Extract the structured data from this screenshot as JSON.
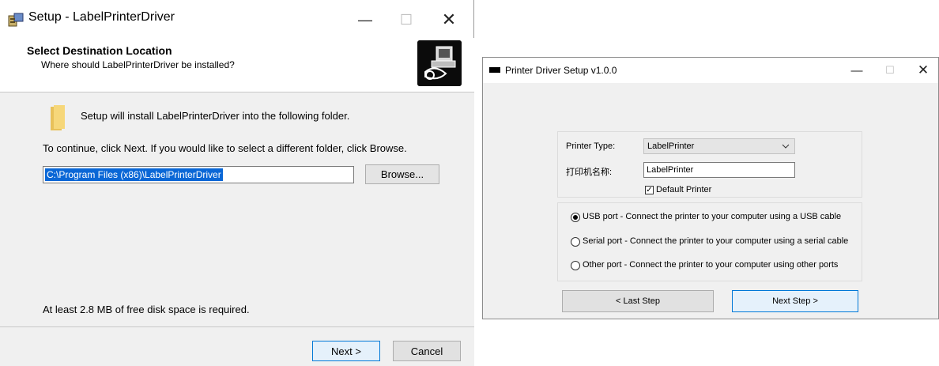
{
  "setup_window": {
    "title": "Setup - LabelPrinterDriver",
    "controls": {
      "minimize": "—",
      "maximize": "☐",
      "close": "✕"
    },
    "header": {
      "title": "Select Destination Location",
      "subtitle": "Where should LabelPrinterDriver be installed?"
    },
    "info_text": "Setup will install LabelPrinterDriver into the following folder.",
    "continue_text": "To continue, click Next. If you would like to select a different folder, click Browse.",
    "path_value": "C:\\Program Files (x86)\\LabelPrinterDriver",
    "browse_label": "Browse...",
    "space_text": "At least 2.8 MB of free disk space is required.",
    "next_label": "Next >",
    "cancel_label": "Cancel"
  },
  "driver_window": {
    "title": "Printer Driver Setup v1.0.0",
    "controls": {
      "minimize": "—",
      "maximize": "☐",
      "close": "✕"
    },
    "printer_type_label": "Printer Type:",
    "printer_type_value": "LabelPrinter",
    "printer_name_label": "打印机名称:",
    "printer_name_value": "LabelPrinter",
    "default_printer_label": "Default Printer",
    "default_printer_checked": true,
    "ports": [
      {
        "label": "USB port - Connect the printer to your computer using a USB cable",
        "selected": true
      },
      {
        "label": "Serial port - Connect the printer to your computer using a serial cable",
        "selected": false
      },
      {
        "label": "Other port - Connect the printer to your computer using other ports",
        "selected": false
      }
    ],
    "last_step_label": "< Last Step",
    "next_step_label": "Next Step >"
  },
  "icons": {
    "setup_app": "setup-installer-icon",
    "folder": "folder-icon",
    "logo": "computer-install-logo-icon",
    "driver_app": "printer-app-icon",
    "dropdown": "chevron-down-icon",
    "checkmark": "✓"
  },
  "colors": {
    "selection": "#0a67d6",
    "default_button_border": "#0078d7",
    "dialog_bg": "#f0f0f0"
  }
}
